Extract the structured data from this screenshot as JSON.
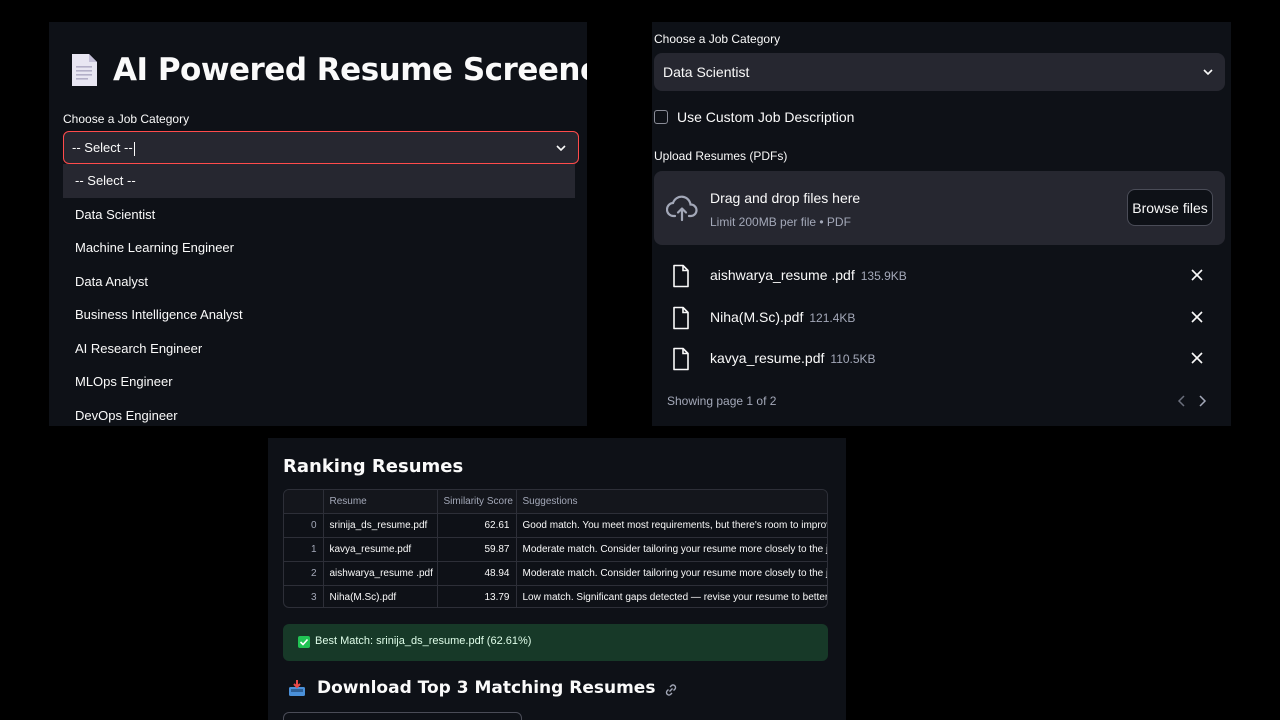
{
  "panel1": {
    "title": "AI Powered Resume Screener",
    "icons": {
      "doc": "page-facing-up-icon",
      "link": "link-icon",
      "chevron": "chevron-down-icon"
    },
    "select_label": "Choose a Job Category",
    "select_value": "-- Select --",
    "options": [
      "-- Select --",
      "Data Scientist",
      "Machine Learning Engineer",
      "Data Analyst",
      "Business Intelligence Analyst",
      "AI Research Engineer",
      "MLOps Engineer",
      "DevOps Engineer"
    ]
  },
  "panel2": {
    "select_label": "Choose a Job Category",
    "select_value": "Data Scientist",
    "checkbox_label": "Use Custom Job Description",
    "upload_label": "Upload Resumes (PDFs)",
    "dropzone_main": "Drag and drop files here",
    "dropzone_sub": "Limit 200MB per file • PDF",
    "browse_label": "Browse files",
    "files": [
      {
        "name": "aishwarya_resume .pdf",
        "size": "135.9KB"
      },
      {
        "name": "Niha(M.Sc).pdf",
        "size": "121.4KB"
      },
      {
        "name": "kavya_resume.pdf",
        "size": "110.5KB"
      }
    ],
    "pager_text": "Showing page 1 of 2",
    "icons": {
      "upload": "cloud-upload-icon",
      "file": "file-icon",
      "remove": "close-icon",
      "prev": "chevron-left-icon",
      "next": "chevron-right-icon"
    }
  },
  "panel3": {
    "ranking_title": "Ranking Resumes",
    "columns": [
      "",
      "Resume",
      "Similarity Score",
      "Suggestions"
    ],
    "rows": [
      {
        "idx": "0",
        "resume": "srinija_ds_resume.pdf",
        "score": "62.61",
        "suggestion": "Good match. You meet most requirements, but there's room to improve."
      },
      {
        "idx": "1",
        "resume": "kavya_resume.pdf",
        "score": "59.87",
        "suggestion": "Moderate match. Consider tailoring your resume more closely to the job."
      },
      {
        "idx": "2",
        "resume": "aishwarya_resume .pdf",
        "score": "48.94",
        "suggestion": "Moderate match. Consider tailoring your resume more closely to the job."
      },
      {
        "idx": "3",
        "resume": "Niha(M.Sc).pdf",
        "score": "13.79",
        "suggestion": "Low match. Significant gaps detected — revise your resume to better align."
      }
    ],
    "best_match": "Best Match: srinija_ds_resume.pdf (62.61%)",
    "download_title": "Download Top 3 Matching Resumes",
    "icons": {
      "check": "check-mark-icon",
      "inbox": "inbox-tray-icon",
      "link": "link-icon"
    },
    "colors": {
      "success_bg": "#173928",
      "accent_red": "#ff4b4b"
    }
  }
}
